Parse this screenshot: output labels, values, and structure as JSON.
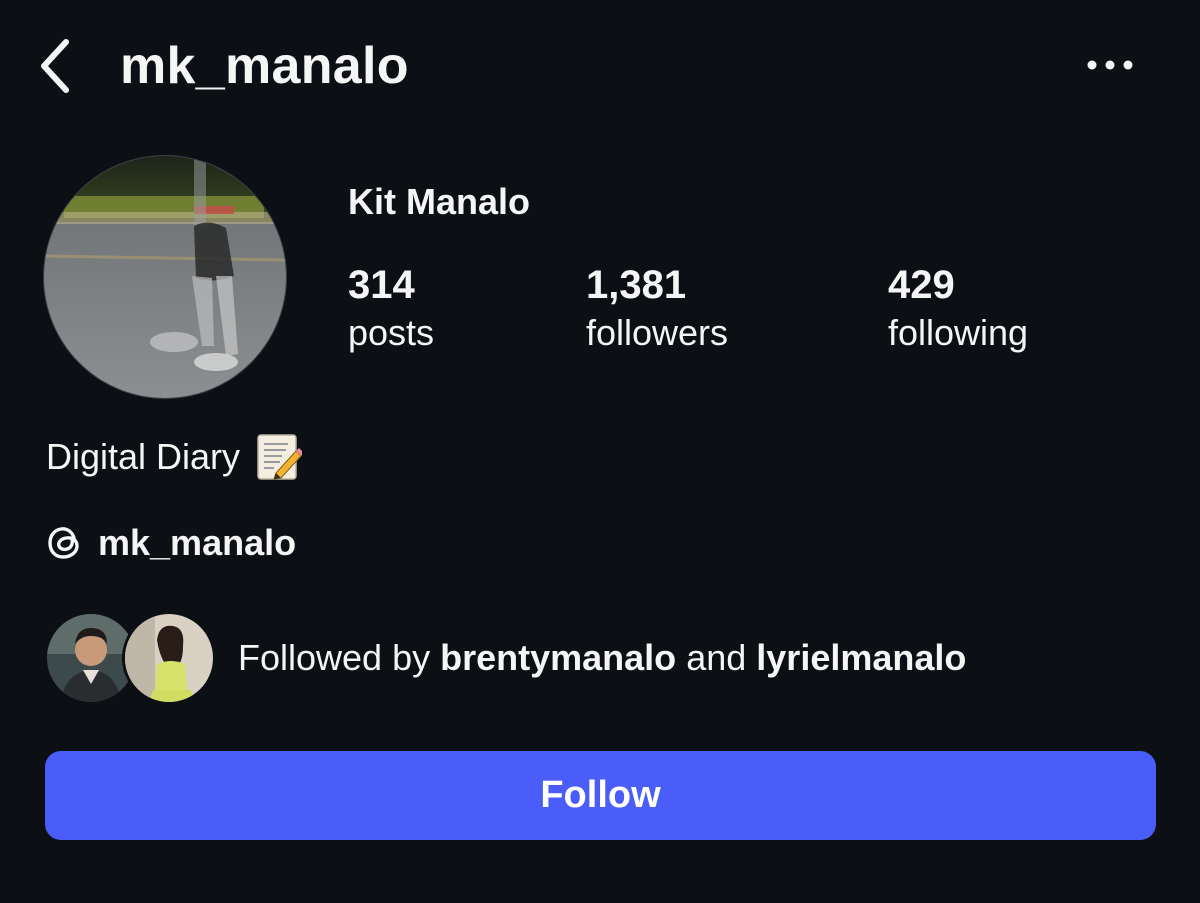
{
  "header": {
    "username": "mk_manalo",
    "back_icon": "chevron-left-icon",
    "more_icon": "more-horizontal-icon"
  },
  "profile": {
    "display_name": "Kit Manalo",
    "stats": [
      {
        "count": "314",
        "label": "posts"
      },
      {
        "count": "1,381",
        "label": "followers"
      },
      {
        "count": "429",
        "label": "following"
      }
    ],
    "bio": "Digital Diary",
    "bio_emoji_icon": "memo-icon",
    "threads_icon": "threads-icon",
    "threads_handle": "mk_manalo"
  },
  "followed_by": {
    "prefix": "Followed by",
    "user1": "brentymanalo",
    "connector": "and",
    "user2": "lyrielmanalo"
  },
  "actions": {
    "follow_label": "Follow"
  },
  "colors": {
    "background": "#0c1014",
    "text": "#f5f5f5",
    "follow_button": "#4a5df9"
  }
}
